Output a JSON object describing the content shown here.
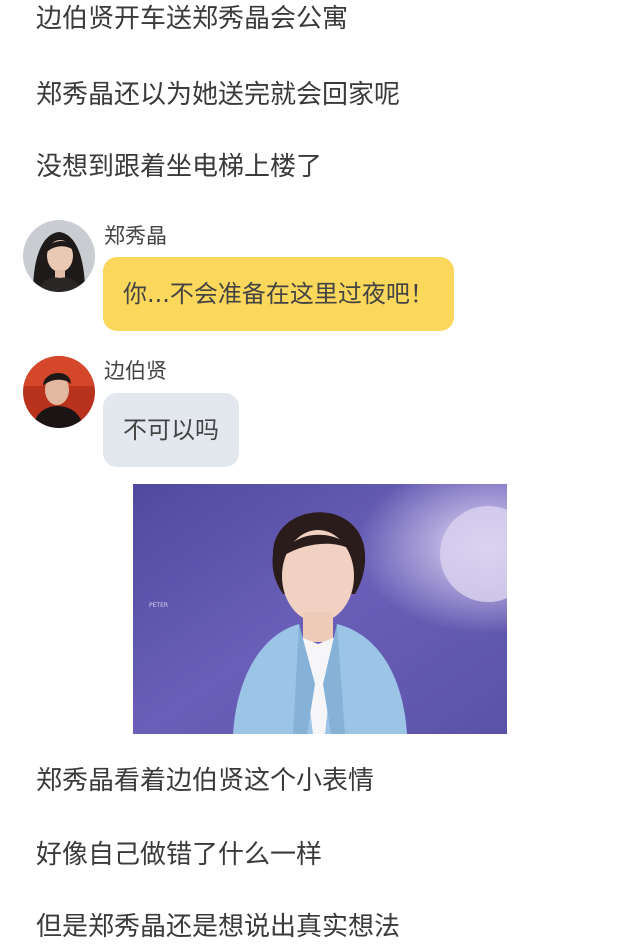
{
  "narration_top": [
    "边伯贤开车送郑秀晶会公寓",
    "郑秀晶还以为她送完就会回家呢",
    "没想到跟着坐电梯上楼了"
  ],
  "messages": [
    {
      "speaker": "郑秀晶",
      "text": "你...不会准备在这里过夜吧！",
      "bubble_color": "#fbd75b"
    },
    {
      "speaker": "边伯贤",
      "text": "不可以吗",
      "bubble_color": "#e3e8ee"
    }
  ],
  "photo": {
    "watermark": "PETER"
  },
  "narration_bottom": [
    "郑秀晶看着边伯贤这个小表情",
    "好像自己做错了什么一样",
    "但是郑秀晶还是想说出真实想法"
  ]
}
